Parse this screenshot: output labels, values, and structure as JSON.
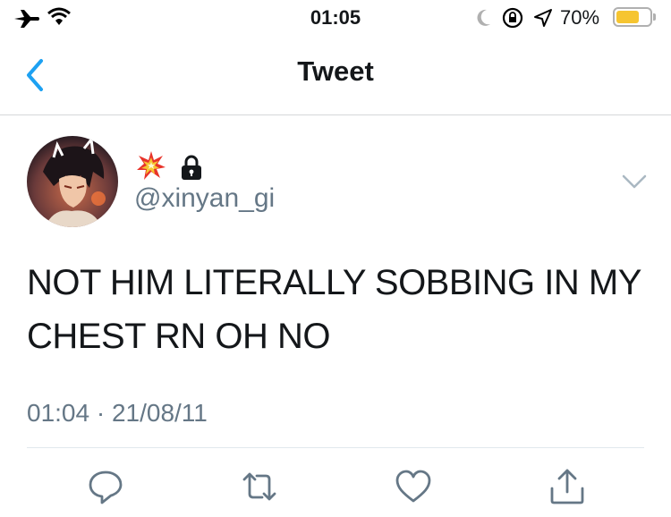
{
  "status_bar": {
    "time": "01:05",
    "battery_percent": "70%",
    "battery_level": 0.7,
    "icons": [
      "airplane-icon",
      "wifi-icon",
      "moon-icon",
      "rotation-lock-icon",
      "location-icon",
      "battery-icon"
    ]
  },
  "nav": {
    "title": "Tweet",
    "back_icon": "chevron-left-icon"
  },
  "tweet": {
    "handle": "@xinyan_gi",
    "badges": [
      "collision-emoji-icon",
      "lock-icon"
    ],
    "text_line1": "NOT HIM LITERALLY SOBBING IN MY",
    "text_line2": "CHEST RN OH NO",
    "timestamp": "01:04 · 21/08/11"
  },
  "actions": [
    "reply-icon",
    "retweet-icon",
    "like-icon",
    "share-icon"
  ],
  "colors": {
    "accent": "#1da1f2",
    "secondary_text": "#657786",
    "battery_yellow": "#f6c531"
  }
}
